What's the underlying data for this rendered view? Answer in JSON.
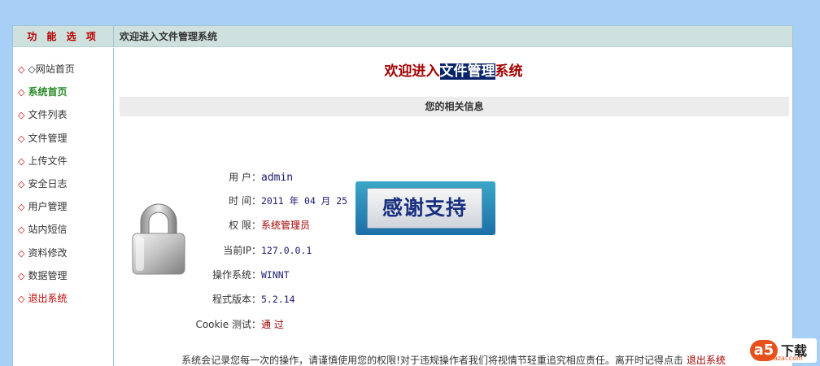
{
  "header": {
    "options_title": "功 能 选 项",
    "breadcrumb": "欢迎进入文件管理系统"
  },
  "sidebar": {
    "items": [
      {
        "label": "◇网站首页"
      },
      {
        "label": "系统首页"
      },
      {
        "label": "文件列表"
      },
      {
        "label": "文件管理"
      },
      {
        "label": "上传文件"
      },
      {
        "label": "安全日志"
      },
      {
        "label": "用户管理"
      },
      {
        "label": "站内短信"
      },
      {
        "label": "资料修改"
      },
      {
        "label": "数据管理"
      },
      {
        "label": "退出系统"
      }
    ],
    "marker": "◇"
  },
  "main": {
    "welcome_prefix": "欢迎进入",
    "welcome_highlight": "文件管理",
    "welcome_suffix": "系统",
    "info_title": "您的相关信息",
    "info": {
      "user_label": "用 户：",
      "user_value": "admin",
      "time_label": "时 间：",
      "time_value": "2011 年 04 月 25",
      "perm_label": "权 限：",
      "perm_value": "系统管理员",
      "ip_label": "当前IP：",
      "ip_value": "127.0.0.1",
      "os_label": "操作系统：",
      "os_value": "WINNT",
      "ver_label": "程式版本：",
      "ver_value": "5.2.14",
      "cookie_label": "Cookie 测试：",
      "cookie_value": "通 过"
    },
    "thanks_banner": "感谢支持",
    "footer_text": "系统会记录您每一次的操作，请谨慎使用您的权限!对于违规操作者我们将视情节轻重追究相应责任。离开时记得点击",
    "footer_logout": "退出系统"
  },
  "watermark": {
    "logo": "a5",
    "text": "下载",
    "site": "xiazai.com"
  },
  "colors": {
    "page_bg": "#a8cff5",
    "topbar_bg": "#cfe1de",
    "accent_red": "#a30000",
    "active_green": "#2a8a2a",
    "highlight_navy": "#0a246a"
  }
}
